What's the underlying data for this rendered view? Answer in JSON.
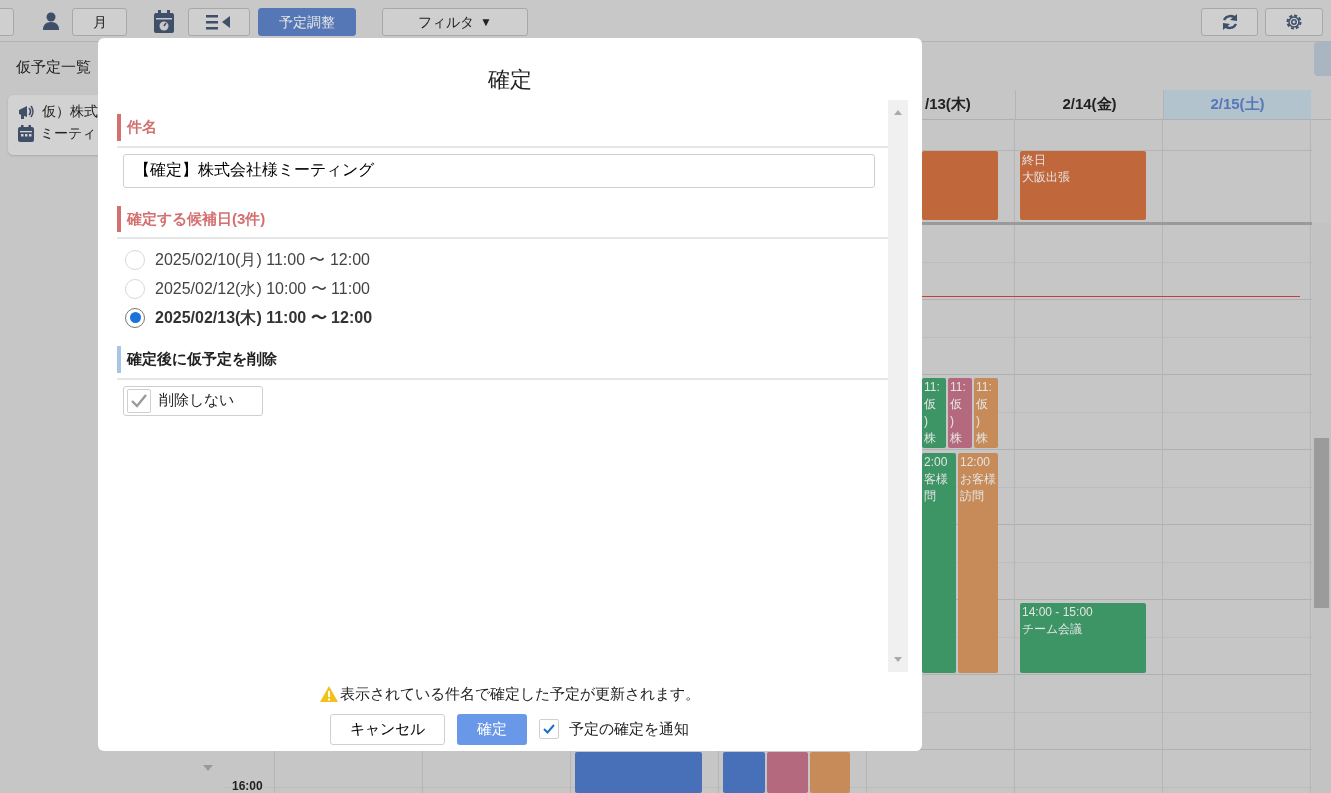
{
  "toolbar": {
    "month_button": "月",
    "adjust_button": "予定調整",
    "filter_button": "フィルタ",
    "filter_caret": "▼"
  },
  "sidebar": {
    "title": "仮予定一覧",
    "items": [
      {
        "kind": "tentative",
        "text": "仮）株式"
      },
      {
        "kind": "calendar",
        "text": "ミーティ"
      }
    ]
  },
  "calendar": {
    "headers": [
      {
        "label": "/13(木)",
        "highlighted": false
      },
      {
        "label": "2/14(金)",
        "highlighted": false
      },
      {
        "label": "2/15(土)",
        "highlighted": true
      }
    ],
    "allday_events": [
      {
        "color": "#c0683b"
      },
      {
        "color": "#c0683b",
        "lines": [
          "終日",
          "大阪出張"
        ]
      }
    ],
    "events": [
      {
        "color": "#3d9566",
        "lines": [
          "11:",
          "仮",
          ")",
          "株"
        ]
      },
      {
        "color": "#b4697f",
        "lines": [
          "11:",
          "仮",
          ")",
          "株"
        ]
      },
      {
        "color": "#c68b58",
        "lines": [
          "11:",
          "仮",
          ")",
          "株"
        ]
      },
      {
        "color": "#3d9566",
        "lines": [
          "2:00",
          "客様",
          "問"
        ]
      },
      {
        "color": "#c68b58",
        "lines": [
          "12:00",
          "お客様",
          "訪問"
        ]
      },
      {
        "color": "#3d9566",
        "lines": [
          "14:00 - 15:00",
          "チーム会議"
        ]
      },
      {
        "color": "#4770b8"
      },
      {
        "color": "#4770b8"
      },
      {
        "color": "#b4697f"
      },
      {
        "color": "#c68b58"
      }
    ],
    "time_label": "16:00"
  },
  "dialog": {
    "title": "確定",
    "subject_label": "件名",
    "subject_value": "【確定】株式会社様ミーティング",
    "candidates_label": "確定する候補日(3件)",
    "candidates": [
      {
        "text": "2025/02/10(月) 11:00 〜 12:00",
        "selected": false
      },
      {
        "text": "2025/02/12(水) 10:00 〜 11:00",
        "selected": false
      },
      {
        "text": "2025/02/13(木) 11:00 〜 12:00",
        "selected": true
      }
    ],
    "delete_label": "確定後に仮予定を削除",
    "delete_option": {
      "label": "削除しない",
      "checked": true
    },
    "warning": "表示されている件名で確定した予定が更新されます。",
    "cancel_button": "キャンセル",
    "confirm_button": "確定",
    "notify": {
      "label": "予定の確定を通知",
      "checked": true
    }
  }
}
